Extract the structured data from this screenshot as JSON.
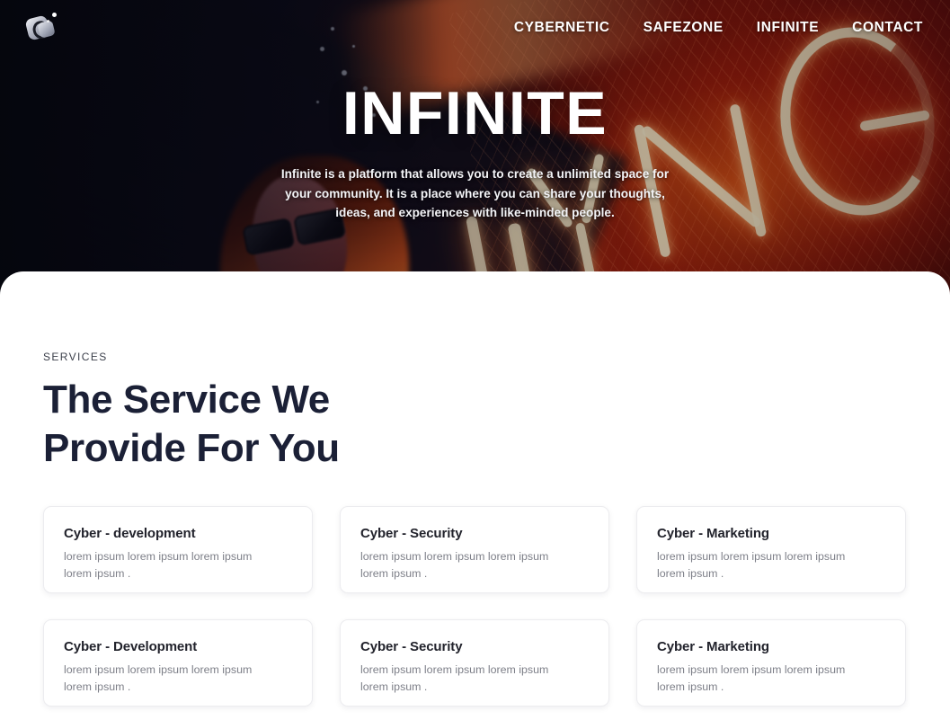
{
  "nav": {
    "logo_icon": "infinite-logo-icon",
    "links": [
      {
        "label": "CYBERNETIC"
      },
      {
        "label": "SAFEZONE"
      },
      {
        "label": "INFINITE"
      },
      {
        "label": "CONTACT"
      }
    ]
  },
  "hero": {
    "title": "INFINITE",
    "subtitle": "Infinite is a platform that allows you to create a unlimited space for your community. It is a place where you can share your thoughts, ideas, and experiences with like-minded people."
  },
  "services": {
    "eyebrow": "SERVICES",
    "title": "The Service We Provide For You",
    "cards": [
      {
        "title": "Cyber - development",
        "desc": "lorem ipsum lorem ipsum lorem ipsum lorem ipsum ."
      },
      {
        "title": "Cyber - Security",
        "desc": "lorem ipsum lorem ipsum lorem ipsum lorem ipsum ."
      },
      {
        "title": "Cyber - Marketing",
        "desc": "lorem ipsum lorem ipsum lorem ipsum lorem ipsum ."
      },
      {
        "title": "Cyber - Development",
        "desc": "lorem ipsum lorem ipsum lorem ipsum lorem ipsum ."
      },
      {
        "title": "Cyber - Security",
        "desc": "lorem ipsum lorem ipsum lorem ipsum lorem ipsum ."
      },
      {
        "title": "Cyber - Marketing",
        "desc": "lorem ipsum lorem ipsum lorem ipsum lorem ipsum ."
      }
    ]
  },
  "colors": {
    "hero_dark": "#0a0b16",
    "hero_red": "#8e1a0c",
    "neon": "#f7eece",
    "heading": "#1b2036",
    "body_text": "#7d7f88",
    "card_border": "#ececef"
  }
}
